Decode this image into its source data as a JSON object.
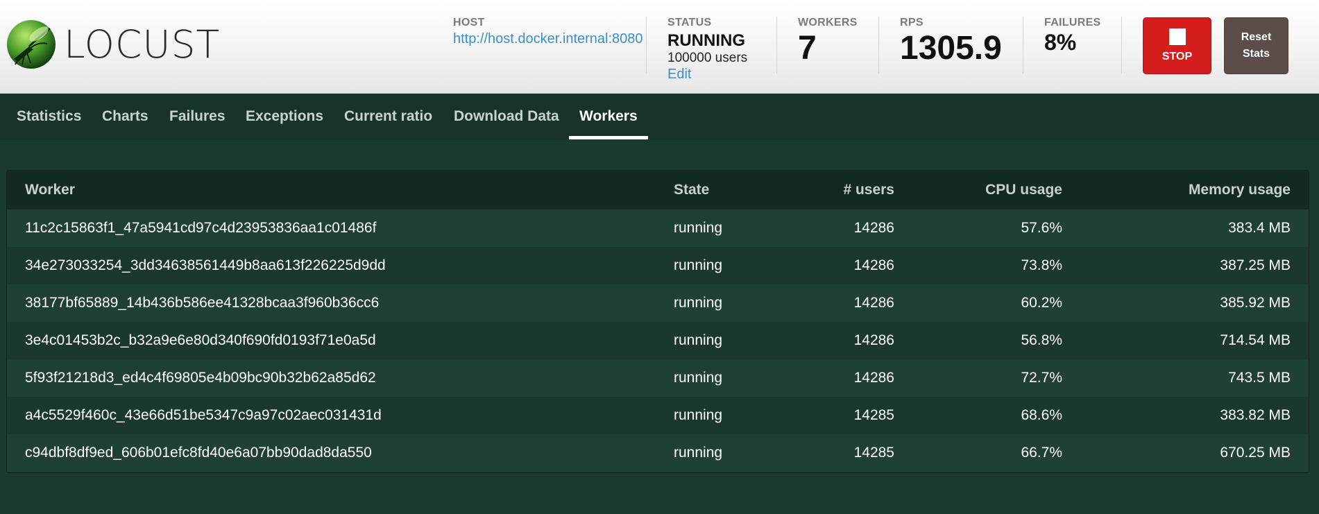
{
  "brand": {
    "name": "LOCUST"
  },
  "header": {
    "host": {
      "label": "HOST",
      "value": "http://host.docker.internal:8080"
    },
    "status": {
      "label": "STATUS",
      "value": "RUNNING",
      "users": "100000 users",
      "edit": "Edit"
    },
    "workers": {
      "label": "WORKERS",
      "value": "7"
    },
    "rps": {
      "label": "RPS",
      "value": "1305.9"
    },
    "failures": {
      "label": "FAILURES",
      "value": "8%"
    },
    "stop_label": "STOP",
    "reset_label": "Reset Stats"
  },
  "nav": {
    "tabs": [
      {
        "label": "Statistics"
      },
      {
        "label": "Charts"
      },
      {
        "label": "Failures"
      },
      {
        "label": "Exceptions"
      },
      {
        "label": "Current ratio"
      },
      {
        "label": "Download Data"
      },
      {
        "label": "Workers"
      }
    ],
    "active": "Workers"
  },
  "table": {
    "headers": [
      "Worker",
      "State",
      "# users",
      "CPU usage",
      "Memory usage"
    ],
    "rows": [
      [
        "11c2c15863f1_47a5941cd97c4d23953836aa1c01486f",
        "running",
        "14286",
        "57.6%",
        "383.4 MB"
      ],
      [
        "34e273033254_3dd34638561449b8aa613f226225d9dd",
        "running",
        "14286",
        "73.8%",
        "387.25 MB"
      ],
      [
        "38177bf65889_14b436b586ee41328bcaa3f960b36cc6",
        "running",
        "14286",
        "60.2%",
        "385.92 MB"
      ],
      [
        "3e4c01453b2c_b32a9e6e80d340f690fd0193f71e0a5d",
        "running",
        "14286",
        "56.8%",
        "714.54 MB"
      ],
      [
        "5f93f21218d3_ed4c4f69805e4b09bc90b32b62a85d62",
        "running",
        "14286",
        "72.7%",
        "743.5 MB"
      ],
      [
        "a4c5529f460c_43e66d51be5347c9a97c02aec031431d",
        "running",
        "14285",
        "68.6%",
        "383.82 MB"
      ],
      [
        "c94dbf8df9ed_606b01efc8fd40e6a07bb90dad8da550",
        "running",
        "14285",
        "66.7%",
        "670.25 MB"
      ]
    ]
  },
  "colors": {
    "stop": "#d41d1d",
    "reset": "#5b4d49",
    "link": "#3a8fc8",
    "background": "#1b3a2e",
    "nav": "#18342a"
  }
}
